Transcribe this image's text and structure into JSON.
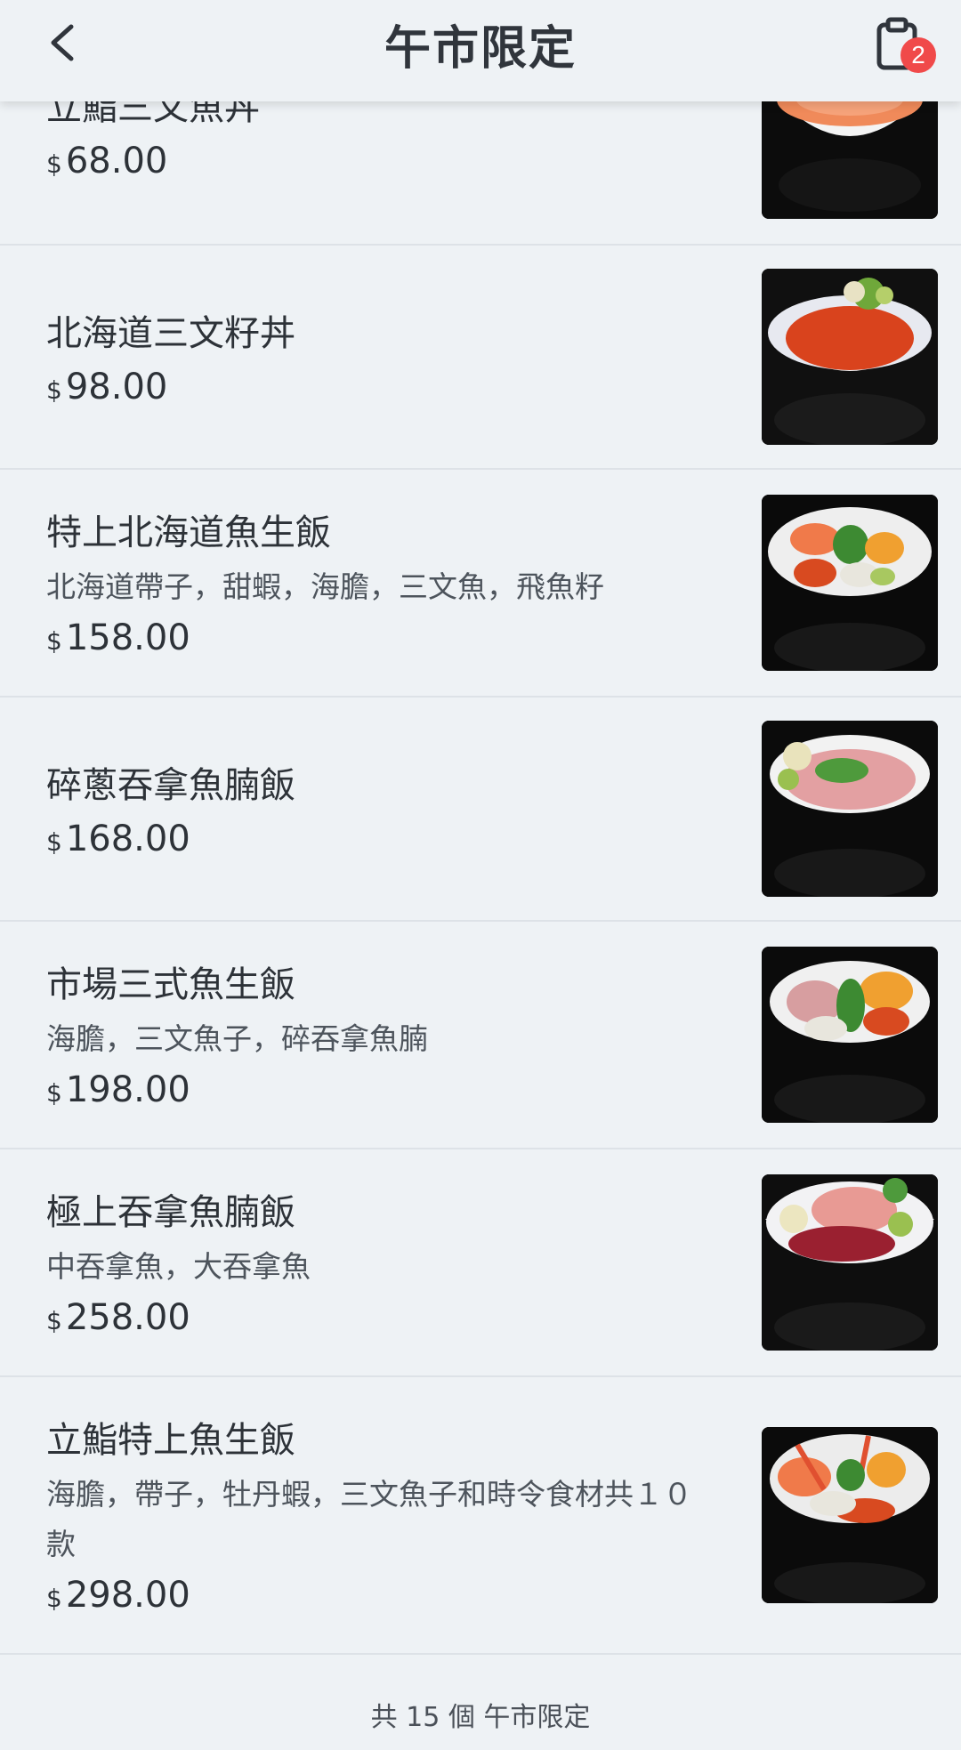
{
  "header": {
    "title": "午市限定",
    "cart_count": "2"
  },
  "items": [
    {
      "name": "立鮨三文魚丼",
      "desc": "",
      "currency": "$",
      "price": "68.00",
      "image": "salmon-don-image"
    },
    {
      "name": "北海道三文籽丼",
      "desc": "",
      "currency": "$",
      "price": "98.00",
      "image": "salmon-roe-don-image"
    },
    {
      "name": "特上北海道魚生飯",
      "desc": "北海道帶子，甜蝦，海膽，三文魚，飛魚籽",
      "currency": "$",
      "price": "158.00",
      "image": "hokkaido-sashimi-rice-image"
    },
    {
      "name": "碎蔥吞拿魚腩飯",
      "desc": "",
      "currency": "$",
      "price": "168.00",
      "image": "negitoro-rice-image"
    },
    {
      "name": "市場三式魚生飯",
      "desc": "海膽，三文魚子，碎吞拿魚腩",
      "currency": "$",
      "price": "198.00",
      "image": "market-three-sashimi-rice-image"
    },
    {
      "name": "極上吞拿魚腩飯",
      "desc": "中吞拿魚，大吞拿魚",
      "currency": "$",
      "price": "258.00",
      "image": "premium-tuna-belly-rice-image"
    },
    {
      "name": "立鮨特上魚生飯",
      "desc": "海膽，帶子，牡丹蝦，三文魚子和時令食材共１０款",
      "currency": "$",
      "price": "298.00",
      "image": "tachi-sushi-premium-rice-image"
    }
  ],
  "footer": {
    "count_text": "共 15 個 午市限定"
  },
  "colors": {
    "background": "#eef2f5",
    "badge": "#f04a4a",
    "divider": "#dde2e7"
  }
}
